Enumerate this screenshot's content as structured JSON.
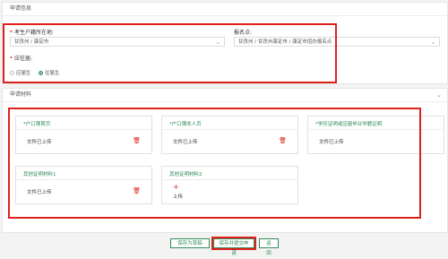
{
  "section1": {
    "title": "申请信息",
    "household_label": "考生户籍所在地:",
    "household_value": "甘孜州 / 康定市",
    "signup_label": "报名点:",
    "signup_value": "甘孜州 / 甘孜州康定市 / 康定市招办报名点",
    "grad_label": "应往届:",
    "option_current": "应届生",
    "option_previous": "往届生"
  },
  "section2": {
    "title": "申请材料",
    "materials": [
      {
        "title": "*户口簿首页",
        "status": "文件已上传",
        "uploaded": true
      },
      {
        "title": "*户口簿本人页",
        "status": "文件已上传",
        "uploaded": true
      },
      {
        "title": "*学历证明或应届毕业学籍证明",
        "status": "文件已上传",
        "uploaded": false
      },
      {
        "title": "其他证明材料1",
        "status": "文件已上传",
        "uploaded": true
      },
      {
        "title": "其他证明材料2",
        "status": "上传",
        "uploaded": false
      }
    ]
  },
  "buttons": {
    "save_draft": "保存为草稿",
    "save_submit": "保存并提交申请",
    "back": "返 回"
  },
  "colors": {
    "accent": "#2e8b57",
    "danger": "#e0211b"
  }
}
